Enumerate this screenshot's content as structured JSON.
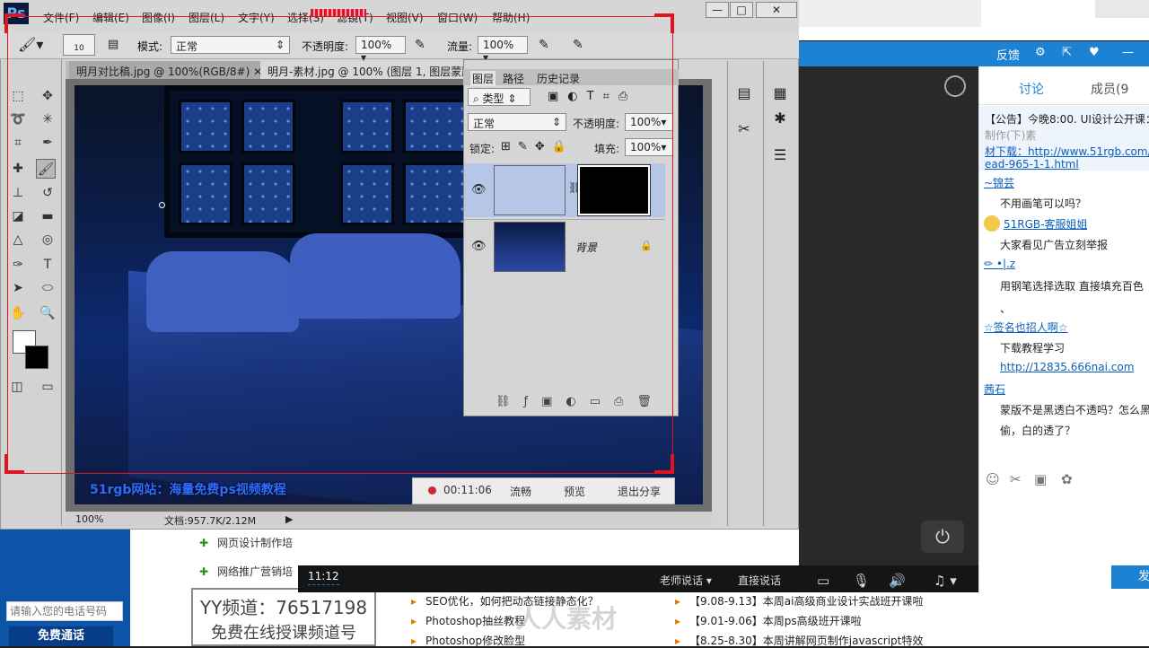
{
  "photoshop": {
    "logo": "Ps",
    "menu": [
      "文件(F)",
      "编辑(E)",
      "图像(I)",
      "图层(L)",
      "文字(Y)",
      "选择(S)",
      "滤镜(T)",
      "视图(V)",
      "窗口(W)",
      "帮助(H)"
    ],
    "window_buttons": [
      "—",
      "□",
      "✕"
    ],
    "options": {
      "brush_size": "10",
      "mode_label": "模式:",
      "mode_value": "正常",
      "opacity_label": "不透明度:",
      "opacity_value": "100%",
      "flow_label": "流量:",
      "flow_value": "100%"
    },
    "doc_tabs": [
      "明月对比稿.jpg @ 100%(RGB/8#)",
      "明月-素材.jpg @ 100% (图层 1, 图层蒙版"
    ],
    "canvas_caption": "51rgb网站：海量免费ps视频教程",
    "status": {
      "zoom": "100%",
      "doc_info": "文档:957.7K/2.12M"
    },
    "layers_panel": {
      "tabs": [
        "图层",
        "路径",
        "历史记录"
      ],
      "filter_label": "类型",
      "blend_mode": "正常",
      "opacity_label": "不透明度:",
      "opacity_value": "100%",
      "lock_label": "锁定:",
      "fill_label": "填充:",
      "fill_value": "100%",
      "layers": [
        {
          "name": ""
        },
        {
          "name": "背景"
        }
      ]
    }
  },
  "share_bar": {
    "time": "00:11:06",
    "smooth": "流畅",
    "preview": "预览",
    "exit": "退出分享"
  },
  "web_header": {
    "feedback": "反馈"
  },
  "player": {
    "time": "11:12",
    "teacher": "老师说话",
    "direct": "直接说话"
  },
  "chat": {
    "tabs": {
      "discuss": "讨论",
      "members": "成员(9"
    },
    "announce_1": "【公告】今晚8:00. UI设计公开课：",
    "announce_2": "制作(下)素",
    "announce_3": "材下载：http://www.51rgb.com/nbbs",
    "announce_4": "ead-965-1-1.html",
    "messages": [
      {
        "user": "~锦芸",
        "text": "不用画笔可以吗？"
      },
      {
        "user": "51RGB-客服姐姐",
        "text": "大家看见广告立刻举报"
      },
      {
        "user": "",
        "text": "✏ •|.z"
      },
      {
        "user": "",
        "text": "用钢笔选择选取    直接填充百色"
      },
      {
        "user": "",
        "text": "、"
      },
      {
        "user": "☆签名也招人啊☆",
        "text": "下载教程学习"
      },
      {
        "user": "",
        "text": "http://12835.666nai.com"
      },
      {
        "user": "茜石",
        "text": "蒙版不是黑透白不透吗？怎么黑"
      },
      {
        "user": "",
        "text": "偷，白的透了？"
      }
    ],
    "send": "发"
  },
  "webpage": {
    "phone_placeholder": "请输入您的电话号码",
    "free_call": "免费通话",
    "courses": [
      "网页设计制作培",
      "网络推广营销培"
    ],
    "yy_channel": "YY频道：76517198",
    "yy_sub": "免费在线授课频道号",
    "news_left": [
      "SEO优化，如何把动态链接静态化？",
      "Photoshop抽丝教程",
      "Photoshop修改脸型"
    ],
    "news_right": [
      "【9.08-9.13】本周ai高级商业设计实战班开课啦",
      "【9.01-9.06】本周ps高级班开课啦",
      "【8.25-8.30】本周讲解网页制作javascript特效"
    ],
    "watermark": "人人素材"
  }
}
